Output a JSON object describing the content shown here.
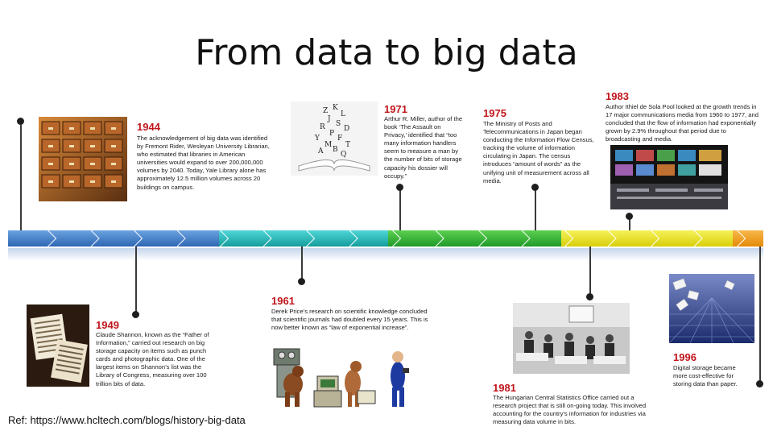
{
  "title": "From data to big data",
  "reference": "Ref: https://www.hcltech.com/blogs/history-big-data",
  "colors": {
    "year": "#c0161c",
    "band_blue": "#3a78c8",
    "band_teal": "#1fb5b5",
    "band_green": "#2fae3a",
    "band_yellow": "#e8e21a",
    "band_orange": "#f09a1a"
  },
  "events": [
    {
      "year": "1944",
      "text": "The acknowledgement of big data was identified by Fremont Rider, Wesleyan University Librarian, who estimated that libraries in American universities would expand to over 200,000,000 volumes by 2040. Today, Yale Library alone has approximately 12.5 million volumes across 20 buildings on campus.",
      "image": "card-catalog-image"
    },
    {
      "year": "1949",
      "text": "Claude Shannon, known as the “Father of Information,” carried out research on big storage capacity on items such as punch cards and photographic data. One of the largest items on Shannon’s list was the Library of Congress, measuring over 100 trillion bits of data.",
      "image": "punch-cards-image"
    },
    {
      "year": "1961",
      "text": "Derek Price’s research on scientific knowledge concluded that scientific journals had doubled every 15 years. This is now better known as “law of exponential increase”.",
      "image": "evolution-image"
    },
    {
      "year": "1971",
      "text": "Arthur R. Miller, author of the book ‘The Assault on Privacy,’ identified that “too many information handlers seem to measure a man by the number of bits of storage capacity his dossier will occupy.”",
      "image": "book-letters-image"
    },
    {
      "year": "1975",
      "text": "The Ministry of Posts and Telecommunications in Japan began conducting the Information Flow Census, tracking the volume of information circulating in Japan. The census introduces “amount of words” as the unifying unit of measurement across all media."
    },
    {
      "year": "1981",
      "text": "The Hungarian Central Statistics Office carried out a research project that is still on-going today. This involved accounting for the country’s information for industries via measuring data volume in bits.",
      "image": "office-photo-image"
    },
    {
      "year": "1983",
      "text": "Author Ithiel de Sola Pool looked at the growth trends in 17 major communications media from 1960 to 1977, and concluded that the flow of information had exponentially grown by 2.9% throughout that period due to broadcasting and media.",
      "image": "broadcast-room-image"
    },
    {
      "year": "1996",
      "text": "Digital storage became more cost-effective for storing data than paper.",
      "image": "digital-storage-image"
    }
  ]
}
